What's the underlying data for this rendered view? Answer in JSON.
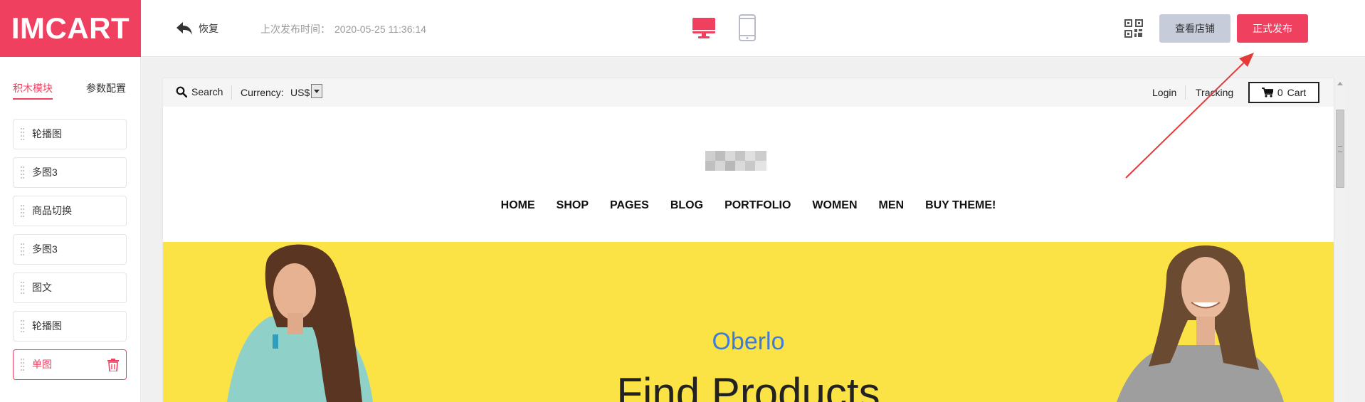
{
  "brand": {
    "logo_text": "IMCART",
    "accent_color": "#ef4060"
  },
  "topbar": {
    "restore_label": "恢复",
    "last_publish_label": "上次发布时间：",
    "last_publish_time": "2020-05-25 11:36:14",
    "devices": [
      {
        "name": "desktop-icon",
        "active": true
      },
      {
        "name": "mobile-icon",
        "active": false
      }
    ],
    "qr_icon": "qr-code-icon",
    "view_store_label": "查看店铺",
    "publish_label": "正式发布"
  },
  "sidebar": {
    "tabs": [
      {
        "label": "积木模块",
        "active": true
      },
      {
        "label": "参数配置",
        "active": false
      }
    ],
    "blocks": [
      {
        "label": "轮播图",
        "active": false
      },
      {
        "label": "多图3",
        "active": false
      },
      {
        "label": "商品切换",
        "active": false
      },
      {
        "label": "多图3",
        "active": false
      },
      {
        "label": "图文",
        "active": false
      },
      {
        "label": "轮播图",
        "active": false
      },
      {
        "label": "单图",
        "active": true
      }
    ]
  },
  "preview": {
    "utility": {
      "search_label": "Search",
      "currency_label": "Currency:",
      "currency_value": "US$",
      "login_label": "Login",
      "tracking_label": "Tracking",
      "cart_count": "0",
      "cart_label": "Cart"
    },
    "nav": [
      "HOME",
      "SHOP",
      "PAGES",
      "BLOG",
      "PORTFOLIO",
      "WOMEN",
      "MEN",
      "BUY THEME!"
    ],
    "hero": {
      "subtitle": "Oberlo",
      "title": "Find Products",
      "background_color": "#fbe346"
    }
  }
}
